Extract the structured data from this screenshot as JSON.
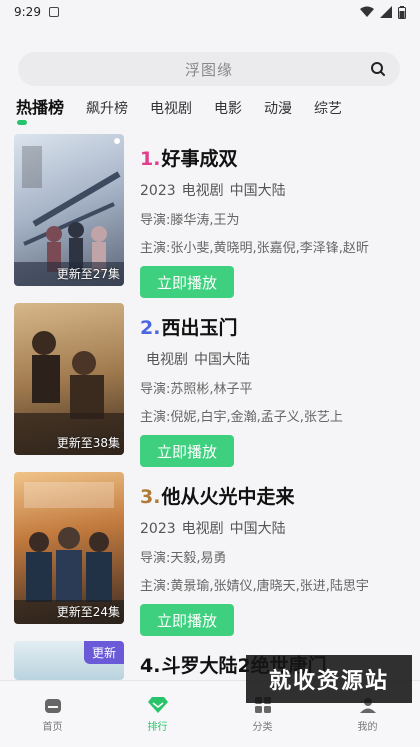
{
  "status_bar": {
    "time": "9:29"
  },
  "search": {
    "placeholder": "浮图缘"
  },
  "tabs": [
    {
      "label": "热播榜",
      "active": true
    },
    {
      "label": "飙升榜"
    },
    {
      "label": "电视剧"
    },
    {
      "label": "电影"
    },
    {
      "label": "动漫"
    },
    {
      "label": "综艺"
    }
  ],
  "items": [
    {
      "rank": "1.",
      "rank_color": "#e23c8c",
      "title": "好事成双",
      "year": "2023",
      "category": "电视剧",
      "region": "中国大陆",
      "director_label": "导演:",
      "director": "滕华涛,王为",
      "cast_label": "主演:",
      "cast": "张小斐,黄晓明,张嘉倪,李泽锋,赵昕",
      "update": "更新至27集",
      "play": "立即播放",
      "poster_color": "#b9c6d8"
    },
    {
      "rank": "2.",
      "rank_color": "#4b67e0",
      "title": "西出玉门",
      "year": "",
      "category": "电视剧",
      "region": "中国大陆",
      "director_label": "导演:",
      "director": "苏照彬,林子平",
      "cast_label": "主演:",
      "cast": "倪妮,白宇,金瀚,孟子义,张艺上",
      "update": "更新至38集",
      "play": "立即播放",
      "poster_color": "#a8835a"
    },
    {
      "rank": "3.",
      "rank_color": "#b07a3a",
      "title": "他从火光中走来",
      "year": "2023",
      "category": "电视剧",
      "region": "中国大陆",
      "director_label": "导演:",
      "director": "天毅,易勇",
      "cast_label": "主演:",
      "cast": "黄景瑜,张婧仪,唐晓天,张进,陆思宇",
      "update": "更新至24集",
      "play": "立即播放",
      "poster_color": "#6b4a36"
    },
    {
      "rank": "4.",
      "rank_color": "#111111",
      "title": "斗罗大陆2绝世唐门",
      "badge": "更新",
      "poster_color": "#cfe3ec"
    }
  ],
  "watermark": "就收资源站",
  "bottom_nav": [
    {
      "label": "首页"
    },
    {
      "label": "排行",
      "active": true
    },
    {
      "label": "分类"
    },
    {
      "label": "我的"
    }
  ],
  "colors": {
    "accent": "#28c46b",
    "button": "#3fd07f"
  }
}
